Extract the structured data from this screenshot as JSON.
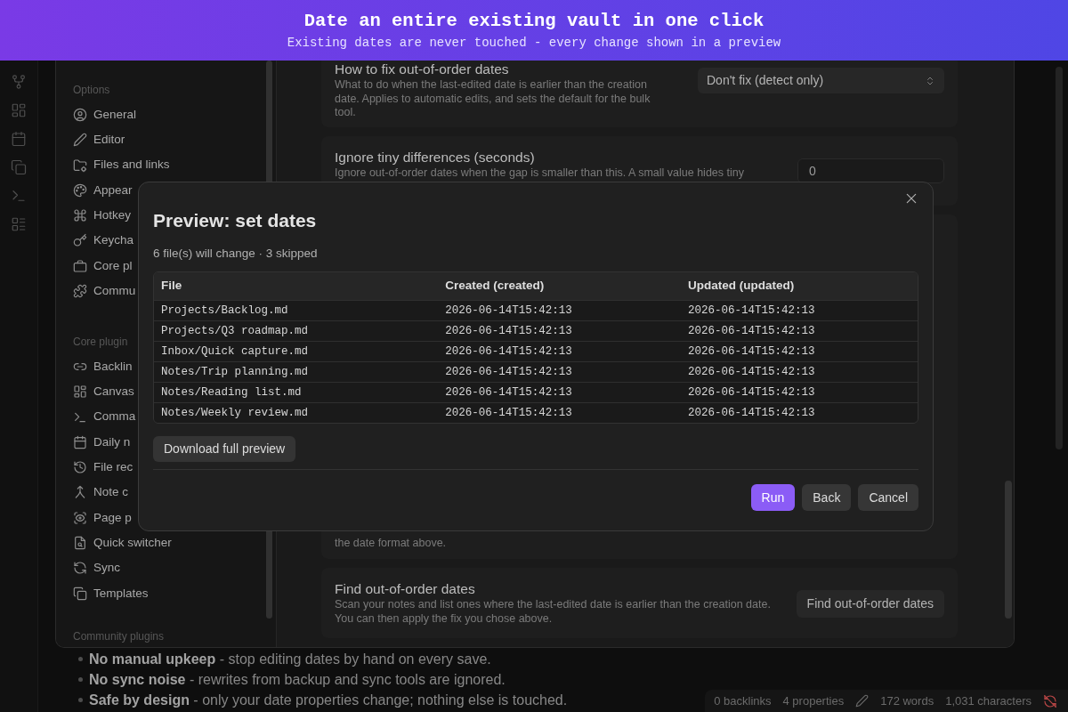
{
  "banner": {
    "title": "Date an entire existing vault in one click",
    "subtitle": "Existing dates are never touched - every change shown in a preview"
  },
  "settings": {
    "sidebar": [
      {
        "heading": "Options",
        "items": [
          "General",
          "Editor",
          "Files and links",
          "Appear",
          "Hotkey",
          "Keycha",
          "Core pl",
          "Commu"
        ]
      },
      {
        "heading": "Core plugin",
        "items": [
          "Backlin",
          "Canvas",
          "Comma",
          "Daily n",
          "File rec",
          "Note c",
          "Page p",
          "Quick switcher",
          "Sync",
          "Templates"
        ]
      },
      {
        "heading": "Community plugins"
      }
    ],
    "items": [
      {
        "title": "How to fix out-of-order dates",
        "description": "What to do when the last-edited date is earlier than the creation date. Applies to automatic edits, and sets the default for the bulk tool.",
        "control": {
          "kind": "select",
          "value": "Don't fix (detect only)"
        }
      },
      {
        "title": "Ignore tiny differences (seconds)",
        "description": "Ignore out-of-order dates when the gap is smaller than this. A small value hides tiny",
        "control": {
          "kind": "number",
          "value": "0"
        }
      },
      {
        "description": "the date format above."
      },
      {
        "title": "Find out-of-order dates",
        "description": "Scan your notes and list ones where the last-edited date is earlier than the creation date. You can then apply the fix you chose above.",
        "control": {
          "kind": "button",
          "label": "Find out-of-order dates"
        }
      }
    ]
  },
  "modal": {
    "title": "Preview: set dates",
    "summary": "6 file(s) will change · 3 skipped",
    "table": {
      "columns": [
        "File",
        "Created (created)",
        "Updated (updated)"
      ],
      "rows": [
        [
          "Projects/Backlog.md",
          "2026-06-14T15:42:13",
          "2026-06-14T15:42:13"
        ],
        [
          "Projects/Q3 roadmap.md",
          "2026-06-14T15:42:13",
          "2026-06-14T15:42:13"
        ],
        [
          "Inbox/Quick capture.md",
          "2026-06-14T15:42:13",
          "2026-06-14T15:42:13"
        ],
        [
          "Notes/Trip planning.md",
          "2026-06-14T15:42:13",
          "2026-06-14T15:42:13"
        ],
        [
          "Notes/Reading list.md",
          "2026-06-14T15:42:13",
          "2026-06-14T15:42:13"
        ],
        [
          "Notes/Weekly review.md",
          "2026-06-14T15:42:13",
          "2026-06-14T15:42:13"
        ]
      ]
    },
    "download_button": "Download full preview",
    "actions": [
      {
        "label": "Run",
        "primary": true
      },
      {
        "label": "Back",
        "primary": false
      },
      {
        "label": "Cancel",
        "primary": false
      }
    ]
  },
  "note": {
    "bullets": [
      "**No manual upkeep** - stop editing dates by hand on every save.",
      "**No sync noise** - rewrites from backup and sync tools are ignored.",
      "**Safe by design** - only your date properties change; nothing else is touched."
    ]
  },
  "status_bar": {
    "items": [
      "0 backlinks",
      "4 properties",
      "172 words",
      "1,031 characters"
    ]
  }
}
